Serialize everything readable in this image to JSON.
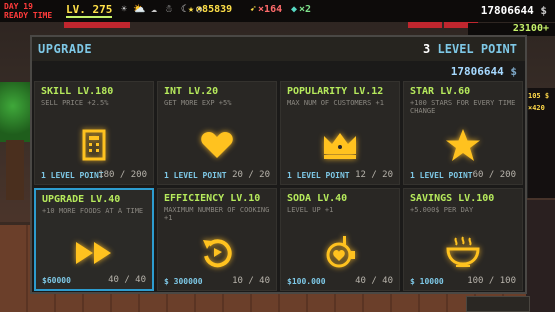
{
  "hud": {
    "day": "DAY 19",
    "status": "READY TIME",
    "level": "LV. 275",
    "icons": [
      "sun-icon",
      "cloud-sun-icon",
      "cloud-icon",
      "snow-cloud-icon",
      "moon-icon",
      "timer-icon"
    ],
    "stars": "×85839",
    "rockets": "×164",
    "gems": "×2",
    "money": "17806644",
    "money_symbol": "$",
    "cash": "23100+"
  },
  "scene": {
    "right_text_1": "105 $",
    "right_text_2": "×420"
  },
  "upgrade": {
    "title": "UPGRADE",
    "level_points_number": "3",
    "level_points_label": "LEVEL POINT",
    "balance": "17806644",
    "balance_symbol": "$",
    "cards": [
      {
        "title": "SKILL LV.180",
        "desc": "SELL PRICE +2.5%",
        "icon": "building-icon",
        "cost": "1 LEVEL POINT",
        "progress": "180 / 200"
      },
      {
        "title": "INT LV.20",
        "desc": "GET MORE EXP +5%",
        "icon": "heart-icon",
        "cost": "1 LEVEL POINT",
        "progress": "20 / 20"
      },
      {
        "title": "POPULARITY LV.12",
        "desc": "MAX NUM OF CUSTOMERS +1",
        "icon": "crown-icon",
        "cost": "1 LEVEL POINT",
        "progress": "12 / 20"
      },
      {
        "title": "STAR LV.60",
        "desc": "+100 STARS FOR EVERY TIME CHANGE",
        "icon": "star-icon",
        "cost": "1 LEVEL POINT",
        "progress": "60 / 200"
      },
      {
        "title": "UPGRADE LV.40",
        "desc": "+10 MORE FOODS AT A TIME",
        "icon": "fast-forward-icon",
        "cost": "$60000",
        "progress": "40 / 40"
      },
      {
        "title": "EFFICIENCY LV.10",
        "desc": "MAXIMUM NUMBER OF COOKING +1",
        "icon": "undo-icon",
        "cost": "$ 300000",
        "progress": "10 / 40"
      },
      {
        "title": "SODA LV.40",
        "desc": "LEVEL UP +1",
        "icon": "soda-icon",
        "cost": "$100.000",
        "progress": "40 / 40"
      },
      {
        "title": "SAVINGS LV.100",
        "desc": "+5.000$ PER DAY",
        "icon": "bowl-icon",
        "cost": "$ 10000",
        "progress": "100 / 100"
      }
    ]
  },
  "colors": {
    "accent_blue": "#7ec8e6",
    "title_green": "#b6ea5c",
    "icon_gold": "#ffc21f",
    "selected_border": "#2d9ccf"
  }
}
